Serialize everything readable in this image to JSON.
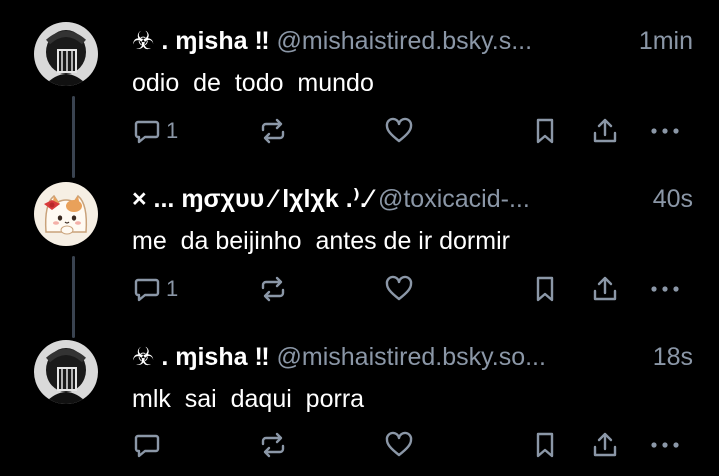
{
  "posts": [
    {
      "display_name": "☣ . ɱisha ‼",
      "handle": "@mishaistired.bsky.s...",
      "time": "1min",
      "text": "odio  de  todo  mundo",
      "reply_count": "1",
      "avatar": "dark-portrait-avatar"
    },
    {
      "display_name": "× ... ɱσχυυ ⁄ lχlχk .⁾.⁄",
      "handle": "@toxicacid-...",
      "time": "40s",
      "text": "me  da beijinho  antes de ir dormir",
      "reply_count": "1",
      "avatar": "cat-with-bow-avatar"
    },
    {
      "display_name": "☣ . ɱisha ‼",
      "handle": "@mishaistired.bsky.so...",
      "time": "18s",
      "text": "mlk  sai  daqui  porra",
      "reply_count": "",
      "avatar": "dark-portrait-avatar"
    }
  ],
  "colors": {
    "background": "#000000",
    "muted": "#8b97a7",
    "thread_line": "#3a4350",
    "text": "#ffffff"
  }
}
